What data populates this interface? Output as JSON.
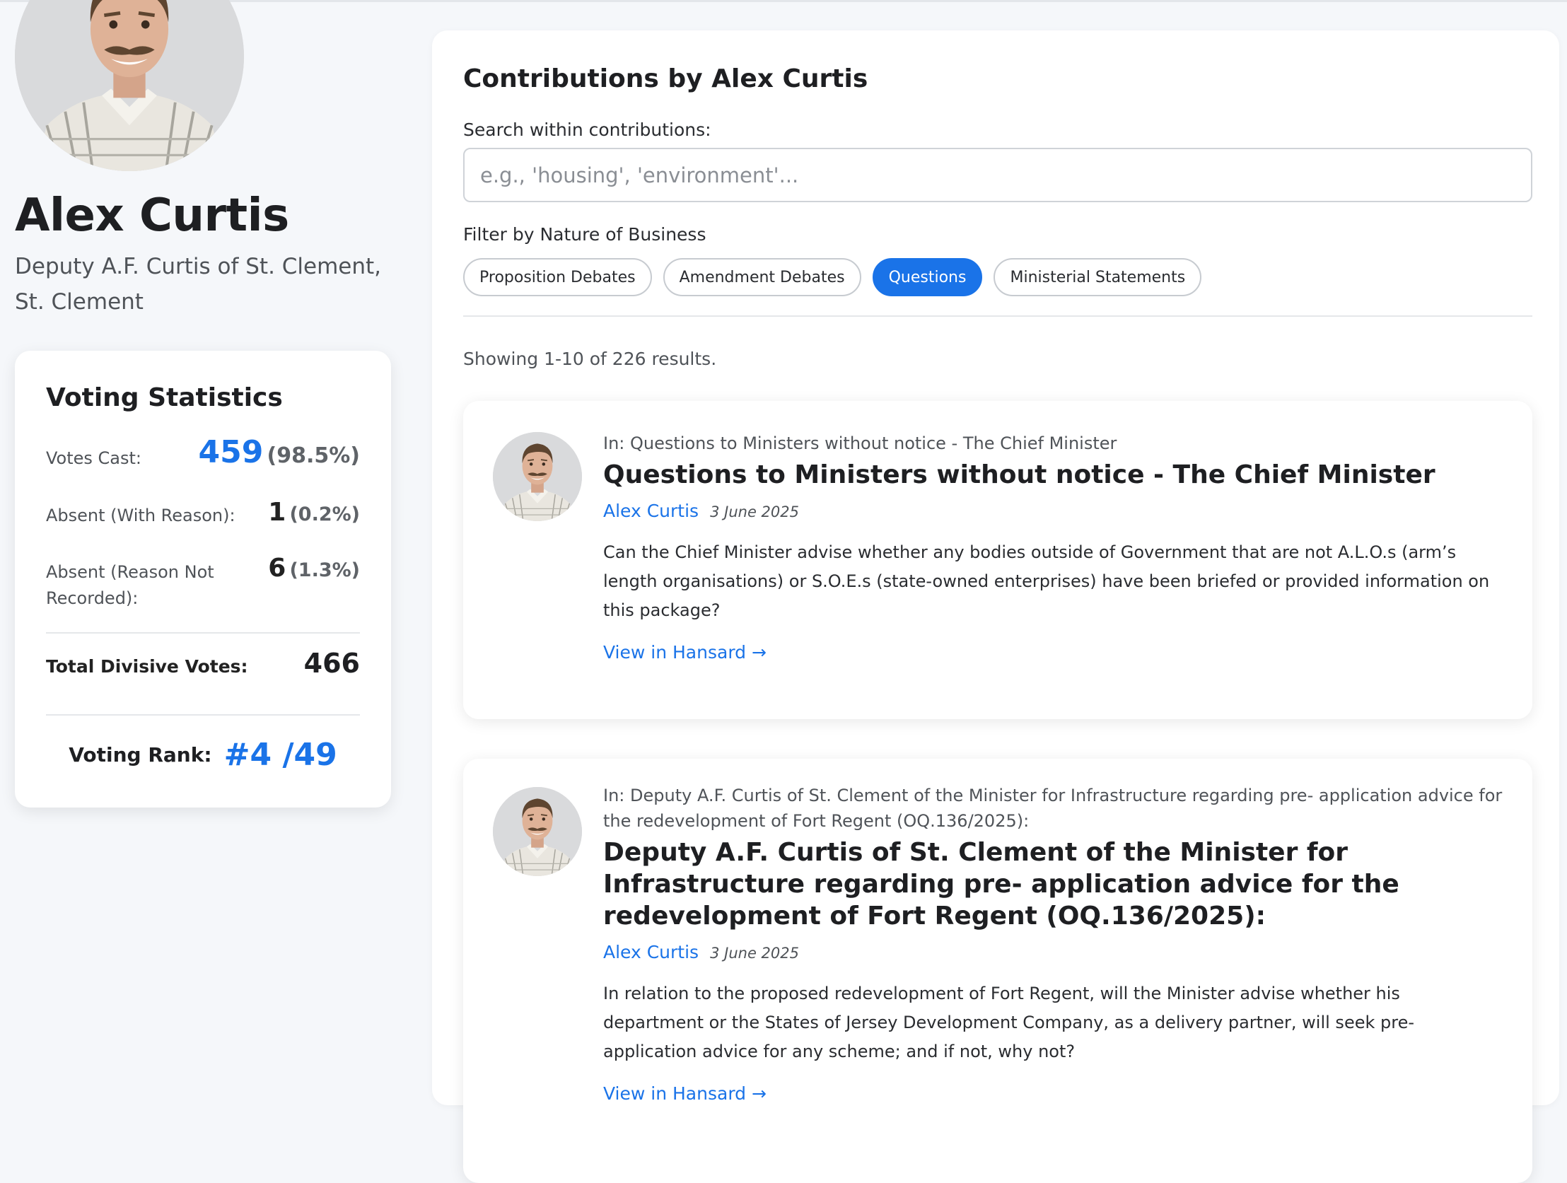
{
  "profile": {
    "name": "Alex Curtis",
    "subtitle": "Deputy A.F. Curtis of St. Clement, St. Clement"
  },
  "voting_stats": {
    "title": "Voting Statistics",
    "votes_cast_label": "Votes Cast:",
    "votes_cast_value": "459",
    "votes_cast_pct": "(98.5%)",
    "absent_reason_label": "Absent (With Reason):",
    "absent_reason_value": "1",
    "absent_reason_pct": "(0.2%)",
    "absent_no_reason_label": "Absent (Reason Not Recorded):",
    "absent_no_reason_value": "6",
    "absent_no_reason_pct": "(1.3%)",
    "total_label": "Total Divisive Votes:",
    "total_value": "466",
    "rank_label": "Voting Rank:",
    "rank_value": "#4 /49"
  },
  "contributions": {
    "title": "Contributions by Alex Curtis",
    "search_label": "Search within contributions:",
    "search_placeholder": "e.g., 'housing', 'environment'...",
    "search_value": "",
    "filter_label": "Filter by Nature of Business",
    "filters": [
      {
        "label": "Proposition Debates",
        "active": false
      },
      {
        "label": "Amendment Debates",
        "active": false
      },
      {
        "label": "Questions",
        "active": true
      },
      {
        "label": "Ministerial Statements",
        "active": false
      }
    ],
    "results_text": "Showing 1-10 of 226 results.",
    "items": [
      {
        "in": "In: Questions to Ministers without notice - The Chief Minister",
        "title": "Questions to Ministers without notice - The Chief Minister",
        "author": "Alex Curtis",
        "date": "3 June 2025",
        "text": "Can the Chief Minister advise whether any bodies outside of Government that are not A.L.O.s (arm’s length organisations) or S.O.E.s (state-owned enterprises) have been briefed or provided information on this package?",
        "link": "View in Hansard →"
      },
      {
        "in": "In: Deputy A.F. Curtis of St. Clement of the Minister for Infrastructure regarding pre- application advice for the redevelopment of Fort Regent (OQ.136/2025):",
        "title": "Deputy A.F. Curtis of St. Clement of the Minister for Infrastructure regarding pre- application advice for the redevelopment of Fort Regent (OQ.136/2025):",
        "author": "Alex Curtis",
        "date": "3 June 2025",
        "text": "In relation to the proposed redevelopment of Fort Regent, will the Minister advise whether his department or the States of Jersey Development Company, as a delivery partner, will seek pre- application advice for any scheme; and if not, why not?",
        "link": "View in Hansard →"
      }
    ]
  }
}
